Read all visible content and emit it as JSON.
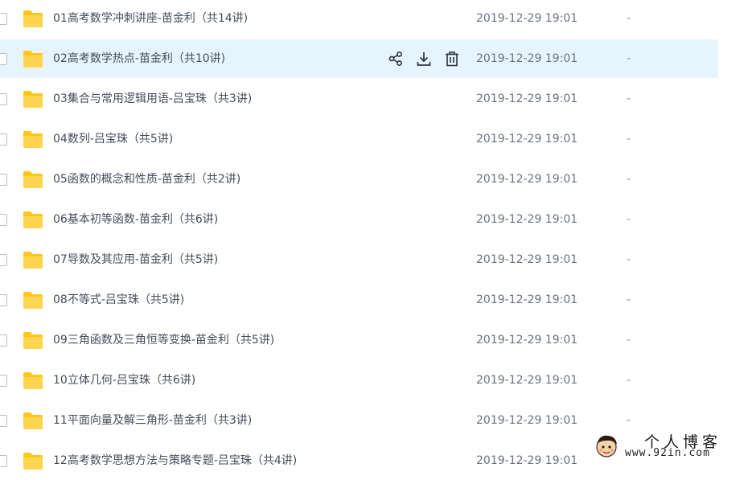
{
  "file_list": {
    "rows": [
      {
        "name": "01高考数学冲刺讲座-苗金利（共14讲)",
        "date": "2019-12-29 19:01",
        "size": "-"
      },
      {
        "name": "02高考数学热点-苗金利（共10讲)",
        "date": "2019-12-29 19:01",
        "size": "-"
      },
      {
        "name": "03集合与常用逻辑用语-吕宝珠（共3讲)",
        "date": "2019-12-29 19:01",
        "size": "-"
      },
      {
        "name": "04数列-吕宝珠（共5讲)",
        "date": "2019-12-29 19:01",
        "size": "-"
      },
      {
        "name": "05函数的概念和性质-苗金利（共2讲)",
        "date": "2019-12-29 19:01",
        "size": "-"
      },
      {
        "name": "06基本初等函数-苗金利（共6讲)",
        "date": "2019-12-29 19:01",
        "size": "-"
      },
      {
        "name": "07导数及其应用-苗金利（共5讲)",
        "date": "2019-12-29 19:01",
        "size": "-"
      },
      {
        "name": "08不等式-吕宝珠（共5讲)",
        "date": "2019-12-29 19:01",
        "size": "-"
      },
      {
        "name": "09三角函数及三角恒等变换-苗金利（共5讲)",
        "date": "2019-12-29 19:01",
        "size": "-"
      },
      {
        "name": "10立体几何-吕宝珠（共6讲)",
        "date": "2019-12-29 19:01",
        "size": "-"
      },
      {
        "name": "11平面向量及解三角形-苗金利（共3讲)",
        "date": "2019-12-29 19:01",
        "size": "-"
      },
      {
        "name": "12高考数学思想方法与策略专题-吕宝珠（共4讲)",
        "date": "2019-12-29 19:01",
        "size": ""
      }
    ],
    "hovered_row": 1,
    "row_actions": [
      "share-icon",
      "download-icon",
      "delete-icon"
    ]
  },
  "watermark": {
    "title": "个人博客",
    "url": "www.92in.com"
  },
  "colors": {
    "folder": "#ffc61a",
    "hover_background": "#e6f5fd",
    "text": "#454d5a"
  }
}
